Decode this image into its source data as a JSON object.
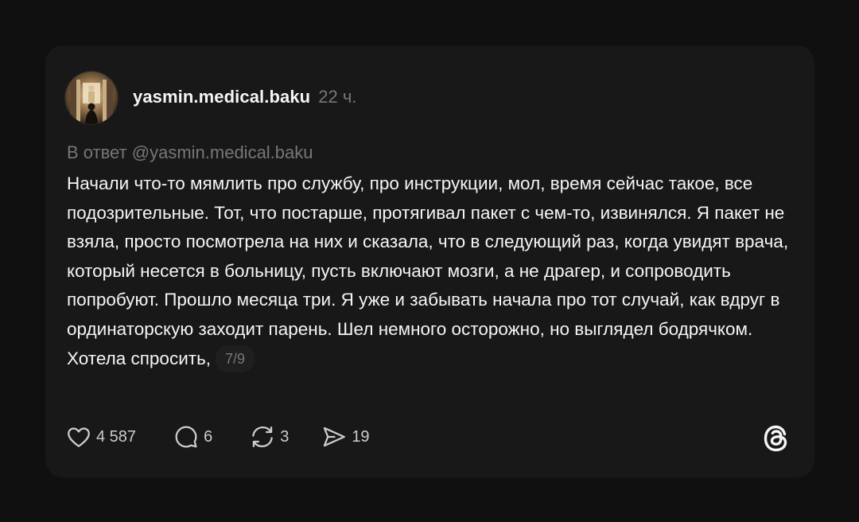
{
  "post": {
    "username": "yasmin.medical.baku",
    "time": "22 ч.",
    "reply_to": "В ответ @yasmin.medical.baku",
    "text": "Начали что-то мямлить про службу, про инструкции, мол, время сейчас такое, все подозрительные. Тот, что постарше, протягивал пакет с чем-то, извинялся. Я пакет не взяла, просто посмотрела на них и сказала, что в следующий раз, когда увидят врача, который несется в больницу, пусть включают мозги, а не драгер, и сопроводить попробуют. Прошло месяца три. Я уже и забывать начала про тот случай, как вдруг в ординаторскую заходит парень. Шел немного осторожно, но выглядел бодрячком. Хотела спросить,",
    "pager": "7/9"
  },
  "actions": {
    "likes": "4 587",
    "comments": "6",
    "reposts": "3",
    "shares": "19"
  },
  "icons": {
    "like": "heart-icon",
    "comment": "comment-bubble-icon",
    "repost": "repost-icon",
    "share": "send-icon",
    "logo": "threads-logo-icon"
  },
  "colors": {
    "background": "#101010",
    "card": "#181818",
    "text": "#f3f5f7",
    "muted": "#777777"
  }
}
